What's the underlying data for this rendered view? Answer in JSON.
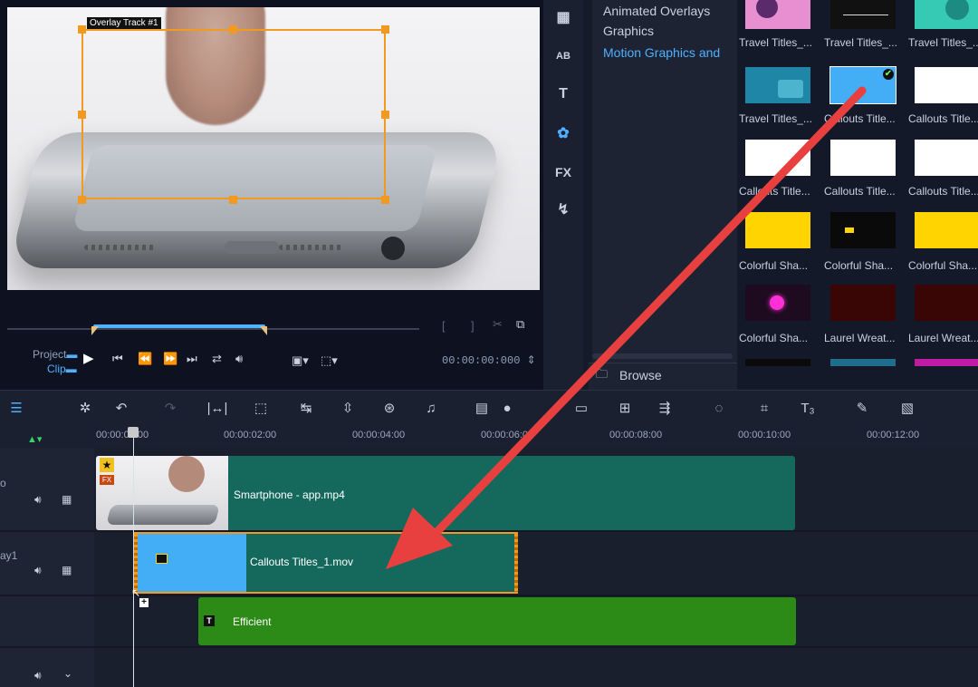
{
  "preview": {
    "overlay_label": "Overlay Track #1",
    "project_label": "Project",
    "clip_label": "Clip",
    "timecode": "00:00:00:000"
  },
  "library": {
    "categories": [
      "Animated Overlays",
      "Graphics",
      "Motion Graphics and"
    ],
    "selected_category": "Motion Graphics and",
    "browse_label": "Browse",
    "side_icons": [
      "instant-project-icon",
      "title-ab-icon",
      "text-t-icon",
      "graphics-icon",
      "fx-icon",
      "path-icon"
    ],
    "fx_label": "FX",
    "thumbnails": [
      {
        "label": "Travel Titles_...",
        "color": "#e78fd0"
      },
      {
        "label": "Travel Titles_...",
        "color": "#111111"
      },
      {
        "label": "Travel Titles_...",
        "color": "#36c9b3"
      },
      {
        "label": "Travel Titles_...",
        "color": "#1f86a8"
      },
      {
        "label": "Callouts Title...",
        "color": "#43adf5"
      },
      {
        "label": "Callouts Title...",
        "color": "#ffffff"
      },
      {
        "label": "Callouts Title...",
        "color": "#ffffff"
      },
      {
        "label": "Callouts Title...",
        "color": "#ffffff"
      },
      {
        "label": "Callouts Title...",
        "color": "#ffffff"
      },
      {
        "label": "Colorful Sha...",
        "color": "#ffd400"
      },
      {
        "label": "Colorful Sha...",
        "color": "#0a0a0a"
      },
      {
        "label": "Colorful Sha...",
        "color": "#ffd400"
      },
      {
        "label": "Colorful Sha...",
        "color": "#1e0b20"
      },
      {
        "label": "Laurel Wreat...",
        "color": "#3a0505"
      },
      {
        "label": "Laurel Wreat...",
        "color": "#3a0505"
      }
    ]
  },
  "timeline": {
    "ruler": [
      "00:00:00:00",
      "00:00:02:00",
      "00:00:04:00",
      "00:00:06:00",
      "00:00:08:00",
      "00:00:10:00",
      "00:00:12:00"
    ],
    "track_labels": [
      "o",
      "ay1"
    ],
    "fx_badge": "FX",
    "clips": {
      "video": "Smartphone - app.mp4",
      "overlay": "Callouts Titles_1.mov",
      "title": "Efficient"
    },
    "title_icon": "T"
  },
  "colors": {
    "accent_orange": "#f29a1f",
    "clip_teal": "#14695c",
    "clip_green": "#2c8a17",
    "callout_blue": "#43adf5",
    "arrow_red": "#e8403f",
    "selected_text": "#4fb0ff"
  }
}
